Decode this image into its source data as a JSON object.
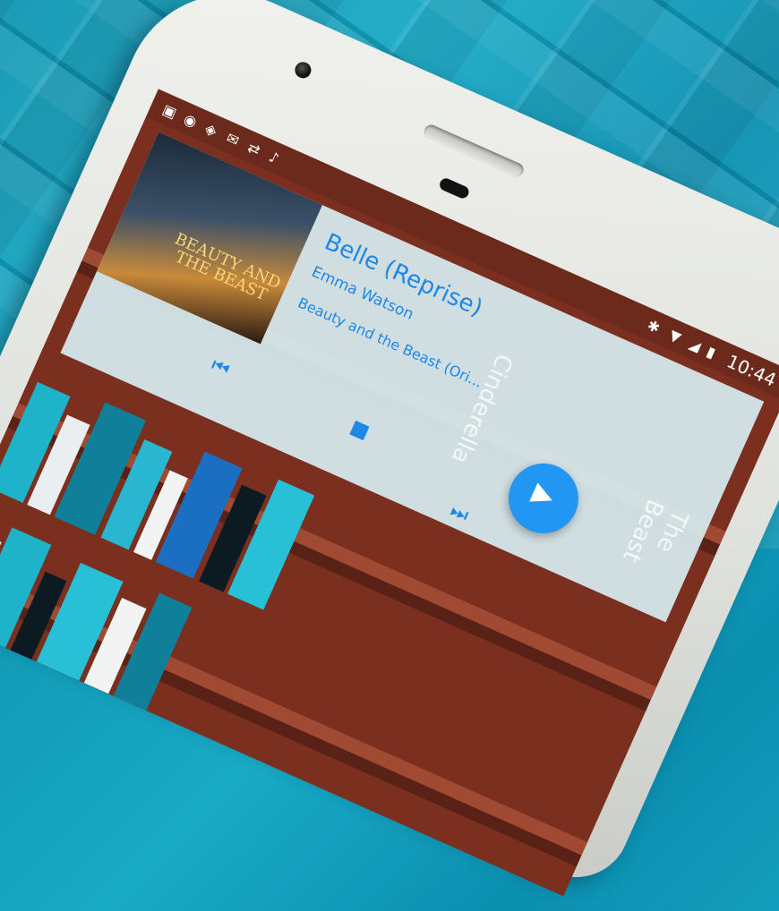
{
  "status_bar": {
    "time": "10:44",
    "left_icons": [
      "cast-icon",
      "camera-icon",
      "photos-icon",
      "mail-icon",
      "sync-icon",
      "music-icon"
    ],
    "right_icons": [
      "bluetooth-icon",
      "wifi-icon",
      "signal-icon",
      "battery-icon"
    ]
  },
  "now_playing": {
    "track_title": "Belle (Reprise)",
    "artist": "Emma Watson",
    "album": "Beauty and the Beast (Ori...",
    "album_art_title": "BEAUTY AND THE BEAST",
    "play_button_icon": "play-icon",
    "controls": [
      "skip-previous-icon",
      "stop-icon",
      "skip-next-icon"
    ]
  },
  "shelf_spines": [
    "Cinderella",
    "The Beast"
  ],
  "colors": {
    "accent": "#2196f3",
    "shelf_wood": "#6b2a1c",
    "card_bg": "#d6ecf0",
    "mat": "#19aac6"
  }
}
